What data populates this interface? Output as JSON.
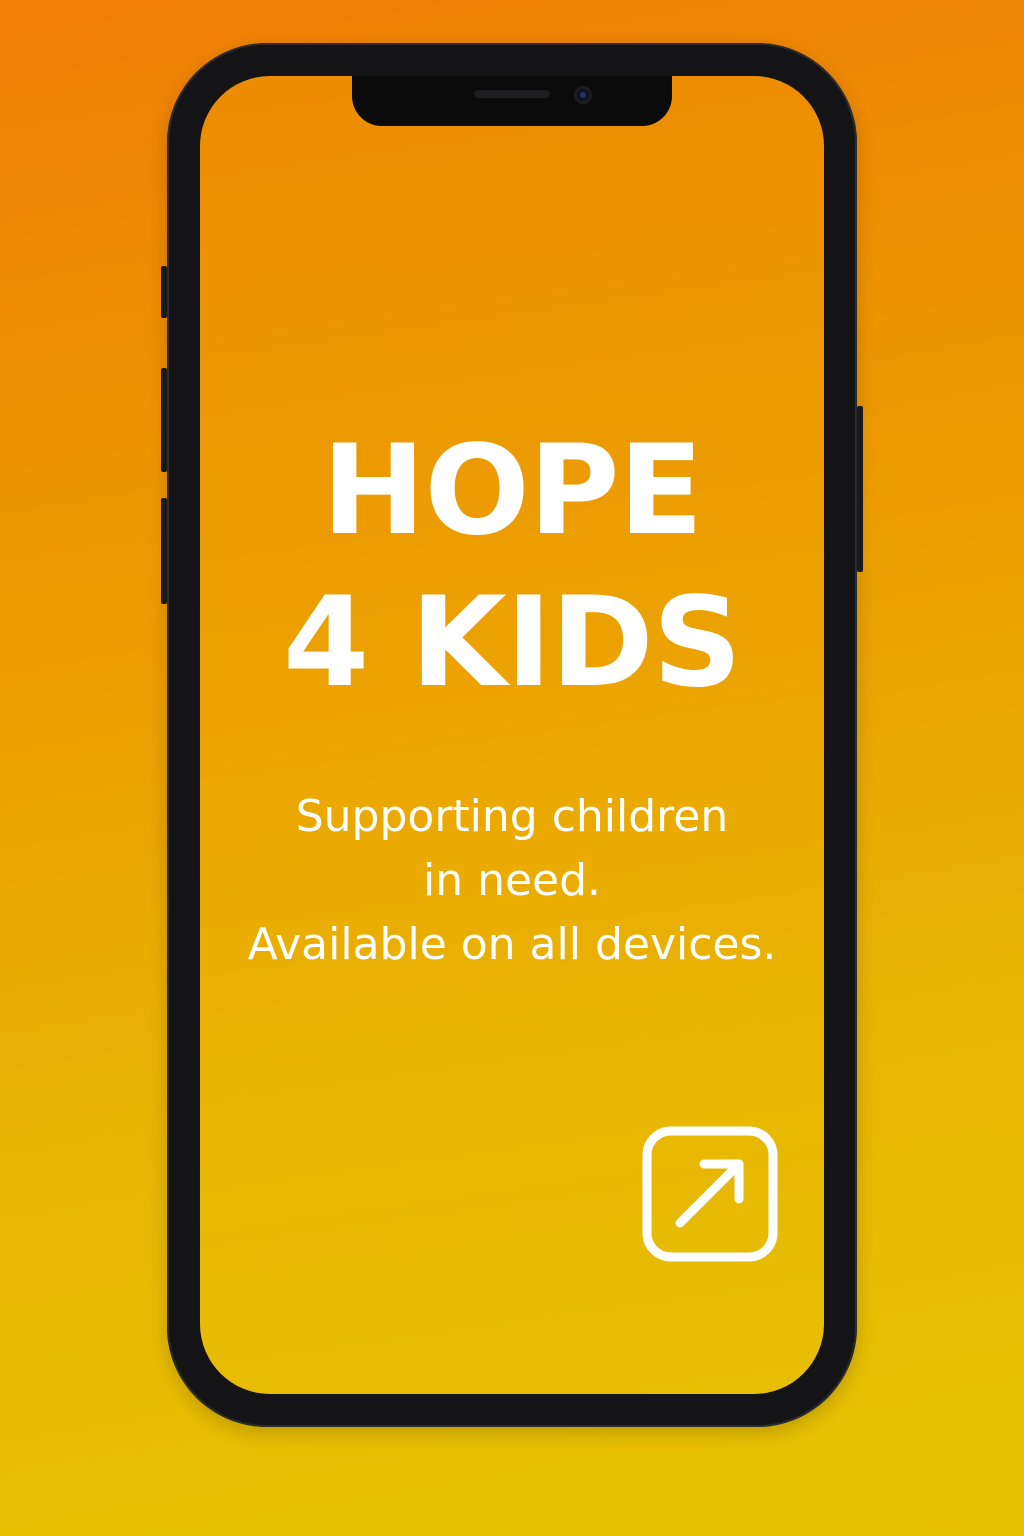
{
  "app": {
    "title_lines": [
      "HOPE",
      "4 KIDS"
    ],
    "subtitle_lines": [
      "Supporting children",
      "in need.",
      "Available on all devices."
    ]
  },
  "actions": {
    "open_link_icon": "open-external-arrow"
  },
  "colors": {
    "background_top": "#ef7f05",
    "background_bottom": "#e6c302",
    "text": "#ffffff",
    "phone_frame": "#141416"
  }
}
